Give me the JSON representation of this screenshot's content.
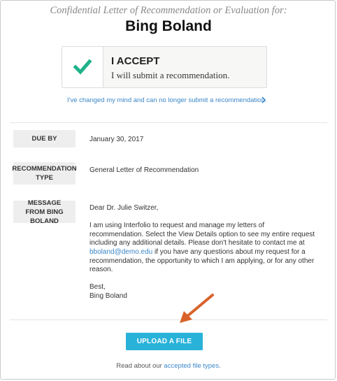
{
  "header": {
    "subtitle": "Confidential Letter of Recommendation or Evaluation for:",
    "name": "Bing Boland"
  },
  "accept": {
    "icon": "checkmark-icon",
    "title": "I ACCEPT",
    "text": "I will submit a recommendation.",
    "check_color": "#1fb28a"
  },
  "decline_link": {
    "text": "I've changed my mind and can no longer submit a recommendation.",
    "icon": "chevron-right-icon"
  },
  "details": {
    "due_by_label": "DUE BY",
    "due_by_value": "January 30, 2017",
    "type_label": "RECOMMENDATION TYPE",
    "type_value": "General Letter of Recommendation",
    "message_label": "MESSAGE FROM BING BOLAND"
  },
  "message": {
    "greeting": "Dear Dr. Julie Switzer,",
    "body_before_email": "I am using Interfolio to request and manage my letters of recommendation. Select the View Details option to see my entire request including any additional details. Please don't hesitate to contact me at",
    "email": "bboland@demo.edu",
    "body_after_email": "if you have any questions about my request for a recommendation, the opportunity to which I am applying, or for any other reason.",
    "closing": "Best,",
    "signature": "Bing Boland"
  },
  "upload": {
    "button_label": "UPLOAD A FILE",
    "button_color": "#29b2d9"
  },
  "footer": {
    "text_before": "Read about our",
    "link": "accepted file types",
    "text_after": "."
  },
  "annotation": {
    "arrow_color": "#d9622b"
  }
}
